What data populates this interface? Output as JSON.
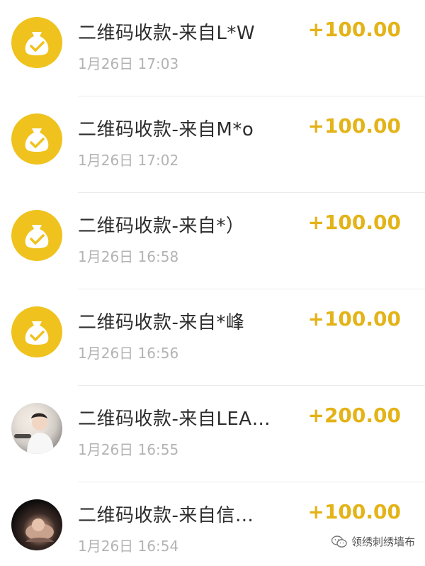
{
  "transactions": [
    {
      "title": "二维码收款-来自L*W",
      "time": "1月26日 17:03",
      "amount": "+100.00",
      "avatar": "money-bag-icon"
    },
    {
      "title": "二维码收款-来自M*o",
      "time": "1月26日 17:02",
      "amount": "+100.00",
      "avatar": "money-bag-icon"
    },
    {
      "title": "二维码收款-来自*）",
      "time": "1月26日 16:58",
      "amount": "+100.00",
      "avatar": "money-bag-icon"
    },
    {
      "title": "二维码收款-来自*峰",
      "time": "1月26日 16:56",
      "amount": "+100.00",
      "avatar": "money-bag-icon"
    },
    {
      "title": "二维码收款-来自LEA…",
      "time": "1月26日 16:55",
      "amount": "+200.00",
      "avatar": "user-photo"
    },
    {
      "title": "二维码收款-来自信…",
      "time": "1月26日 16:54",
      "amount": "+100.00",
      "avatar": "user-photo"
    }
  ],
  "watermark": {
    "text": "领绣刺绣墙布",
    "icon": "wechat-icon"
  },
  "colors": {
    "amount": "#e3b318",
    "coin": "#efc21e",
    "title": "#2d2d2d",
    "time": "#b3b3b3"
  }
}
